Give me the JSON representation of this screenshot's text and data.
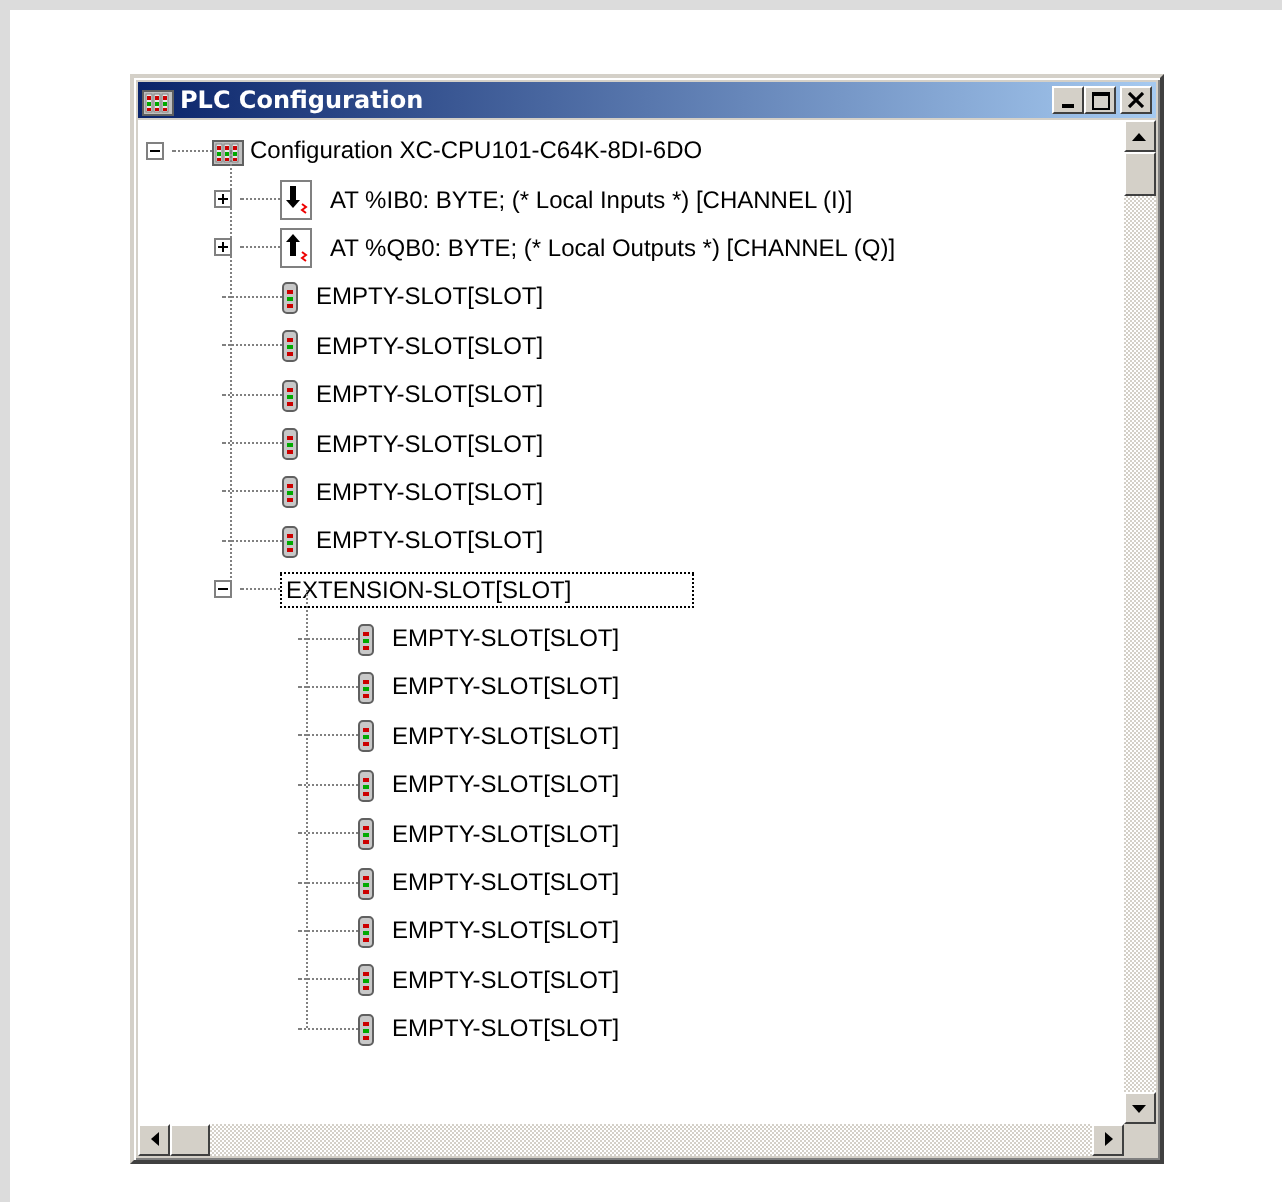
{
  "window": {
    "title": "PLC Configuration"
  },
  "tree": {
    "label": "Configuration XC-CPU101-C64K-8DI-6DO",
    "kind": "rack",
    "expanded": true,
    "selected": false,
    "children": [
      {
        "label": "AT %IB0: BYTE; (* Local Inputs *) [CHANNEL (I)]",
        "kind": "input",
        "expanded": false,
        "selected": false
      },
      {
        "label": "AT %QB0: BYTE; (* Local Outputs *) [CHANNEL (Q)]",
        "kind": "output",
        "expanded": false,
        "selected": false
      },
      {
        "label": "EMPTY-SLOT[SLOT]",
        "kind": "slot",
        "selected": false
      },
      {
        "label": "EMPTY-SLOT[SLOT]",
        "kind": "slot",
        "selected": false
      },
      {
        "label": "EMPTY-SLOT[SLOT]",
        "kind": "slot",
        "selected": false
      },
      {
        "label": "EMPTY-SLOT[SLOT]",
        "kind": "slot",
        "selected": false
      },
      {
        "label": "EMPTY-SLOT[SLOT]",
        "kind": "slot",
        "selected": false
      },
      {
        "label": "EMPTY-SLOT[SLOT]",
        "kind": "slot",
        "selected": false
      },
      {
        "label": "EXTENSION-SLOT[SLOT]",
        "kind": "none",
        "expanded": true,
        "selected": true,
        "children": [
          {
            "label": "EMPTY-SLOT[SLOT]",
            "kind": "slot",
            "selected": false
          },
          {
            "label": "EMPTY-SLOT[SLOT]",
            "kind": "slot",
            "selected": false
          },
          {
            "label": "EMPTY-SLOT[SLOT]",
            "kind": "slot",
            "selected": false
          },
          {
            "label": "EMPTY-SLOT[SLOT]",
            "kind": "slot",
            "selected": false
          },
          {
            "label": "EMPTY-SLOT[SLOT]",
            "kind": "slot",
            "selected": false
          },
          {
            "label": "EMPTY-SLOT[SLOT]",
            "kind": "slot",
            "selected": false
          },
          {
            "label": "EMPTY-SLOT[SLOT]",
            "kind": "slot",
            "selected": false
          },
          {
            "label": "EMPTY-SLOT[SLOT]",
            "kind": "slot",
            "selected": false
          },
          {
            "label": "EMPTY-SLOT[SLOT]",
            "kind": "slot",
            "selected": false
          }
        ]
      }
    ]
  }
}
